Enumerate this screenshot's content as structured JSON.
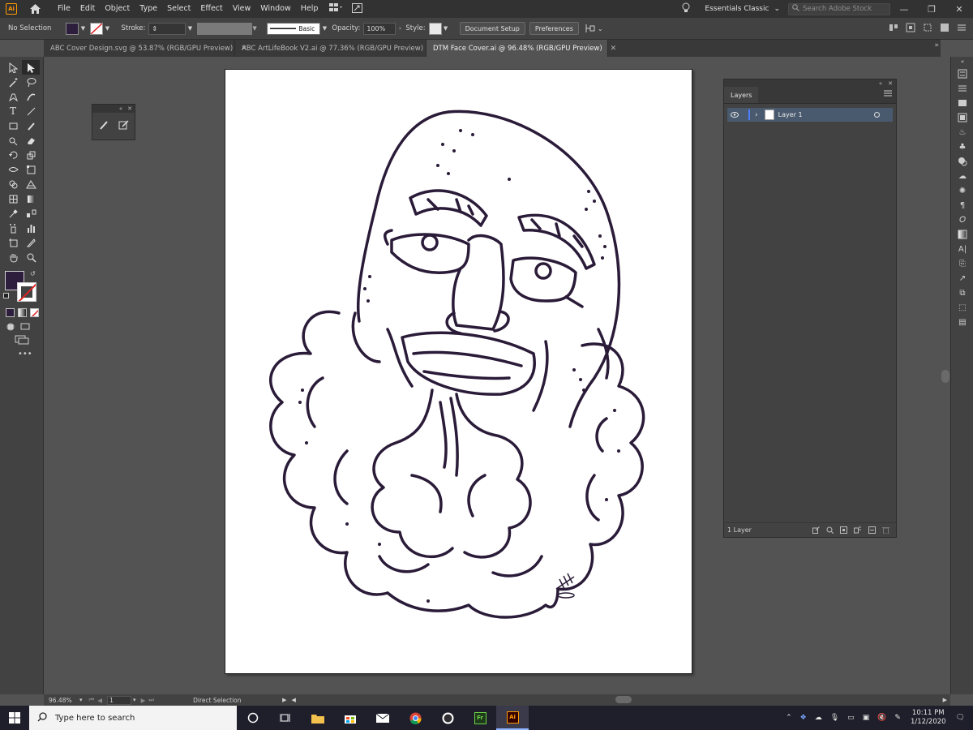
{
  "app": {
    "logo": "Ai",
    "brand_color": "#ff9a00"
  },
  "menu": [
    "File",
    "Edit",
    "Object",
    "Type",
    "Select",
    "Effect",
    "View",
    "Window",
    "Help"
  ],
  "workspace": {
    "label": "Essentials Classic"
  },
  "stock_search": {
    "placeholder": "Search Adobe Stock"
  },
  "control": {
    "selection_label": "No Selection",
    "fill_color": "#2d1e3e",
    "stroke_label": "Stroke:",
    "brush_label": "Basic",
    "opacity_label": "Opacity:",
    "opacity_value": "100%",
    "style_label": "Style:",
    "document_setup": "Document Setup",
    "preferences": "Preferences"
  },
  "tabs": [
    {
      "label": "ABC Cover Design.svg @ 53.87% (RGB/GPU Preview)",
      "active": false
    },
    {
      "label": "ABC ArtLifeBook V2.ai @ 77.36% (RGB/GPU Preview)",
      "active": false
    },
    {
      "label": "DTM Face Cover.ai @ 96.48% (RGB/GPU Preview)",
      "active": true
    }
  ],
  "layers_panel": {
    "tab": "Layers",
    "layers": [
      {
        "name": "Layer 1",
        "visible": true
      }
    ],
    "count_label": "1 Layer"
  },
  "status": {
    "zoom": "96.48%",
    "artboard": "1",
    "tool": "Direct Selection"
  },
  "taskbar": {
    "search_placeholder": "Type here to search",
    "time": "10:11 PM",
    "date": "1/12/2020"
  }
}
